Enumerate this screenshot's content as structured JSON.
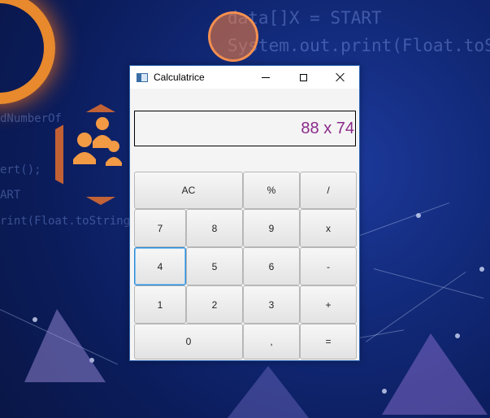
{
  "window": {
    "title": "Calculatrice"
  },
  "display": {
    "value": "88 x 74"
  },
  "keys": {
    "ac": "AC",
    "percent": "%",
    "divide": "/",
    "seven": "7",
    "eight": "8",
    "nine": "9",
    "multiply": "x",
    "four": "4",
    "five": "5",
    "six": "6",
    "minus": "-",
    "one": "1",
    "two": "2",
    "three": "3",
    "plus": "+",
    "zero": "0",
    "comma": ",",
    "equals": "="
  },
  "background": {
    "code_lines": [
      "data[]X = START",
      "System.out.print(Float.toSt",
      "dNumberOf",
      "ert();",
      "ART",
      "rint(Float.toString(da"
    ]
  },
  "colors": {
    "display_text": "#8b2a8b",
    "title_border": "#2f66b5",
    "focus_ring": "#2a8ad8"
  }
}
